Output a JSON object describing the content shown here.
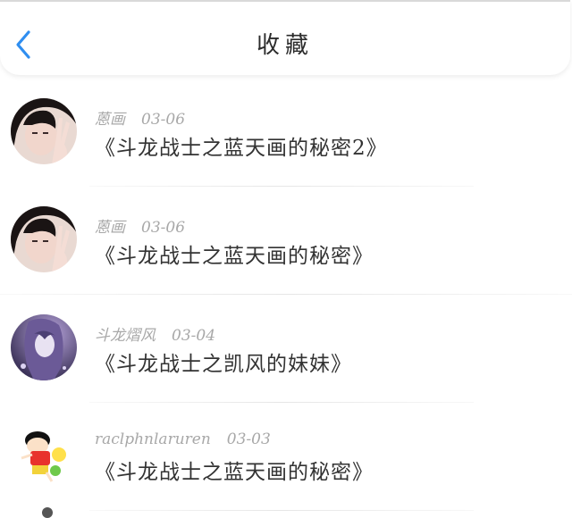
{
  "header": {
    "title": "收藏",
    "back_icon": "chevron-left-icon",
    "accent_color": "#2f8ef0"
  },
  "favorites": [
    {
      "user": "蒽画",
      "date": "03-06",
      "title": "《斗龙战士之蓝天画的秘密2》",
      "avatar_icon": "girl-peace-sign-avatar"
    },
    {
      "user": "蒽画",
      "date": "03-06",
      "title": "《斗龙战士之蓝天画的秘密》",
      "avatar_icon": "girl-peace-sign-avatar"
    },
    {
      "user": "斗龙熠风",
      "date": "03-04",
      "title": "《斗龙战士之凯风的妹妹》",
      "avatar_icon": "anime-girl-purple-avatar"
    },
    {
      "user": "raclphnlaruren",
      "date": "03-03",
      "title": "《斗龙战士之蓝天画的秘密》",
      "avatar_icon": "cartoon-boy-avatar"
    }
  ]
}
